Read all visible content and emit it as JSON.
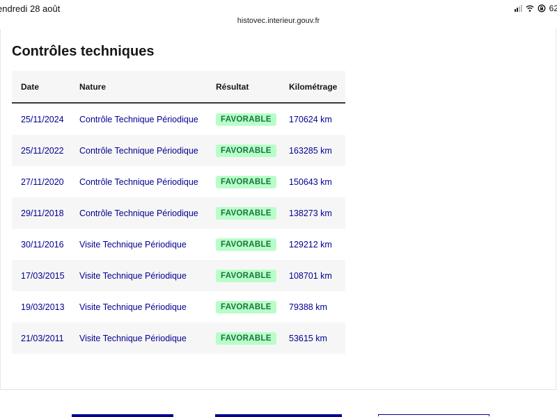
{
  "status_bar": {
    "date": "endredi 28 août",
    "battery": "62",
    "icons": [
      "signal-icon",
      "wifi-icon",
      "lock-rotation-icon"
    ]
  },
  "browser": {
    "url": "histovec.interieur.gouv.fr"
  },
  "section": {
    "title": "Contrôles techniques"
  },
  "table": {
    "headers": {
      "date": "Date",
      "nature": "Nature",
      "result": "Résultat",
      "km": "Kilométrage"
    },
    "rows": [
      {
        "date": "25/11/2024",
        "nature": "Contrôle Technique Périodique",
        "result": "FAVORABLE",
        "km": "170624 km"
      },
      {
        "date": "25/11/2022",
        "nature": "Contrôle Technique Périodique",
        "result": "FAVORABLE",
        "km": "163285 km"
      },
      {
        "date": "27/11/2020",
        "nature": "Contrôle Technique Périodique",
        "result": "FAVORABLE",
        "km": "150643 km"
      },
      {
        "date": "29/11/2018",
        "nature": "Contrôle Technique Périodique",
        "result": "FAVORABLE",
        "km": "138273 km"
      },
      {
        "date": "30/11/2016",
        "nature": "Visite Technique Périodique",
        "result": "FAVORABLE",
        "km": "129212 km"
      },
      {
        "date": "17/03/2015",
        "nature": "Visite Technique Périodique",
        "result": "FAVORABLE",
        "km": "108701 km"
      },
      {
        "date": "19/03/2013",
        "nature": "Visite Technique Périodique",
        "result": "FAVORABLE",
        "km": "79388 km"
      },
      {
        "date": "21/03/2011",
        "nature": "Visite Technique Périodique",
        "result": "FAVORABLE",
        "km": "53615 km"
      }
    ]
  },
  "colors": {
    "link_blue": "#000091",
    "badge_bg": "#b8fec9",
    "badge_text": "#18753c",
    "stripe": "#f6f6f6"
  }
}
